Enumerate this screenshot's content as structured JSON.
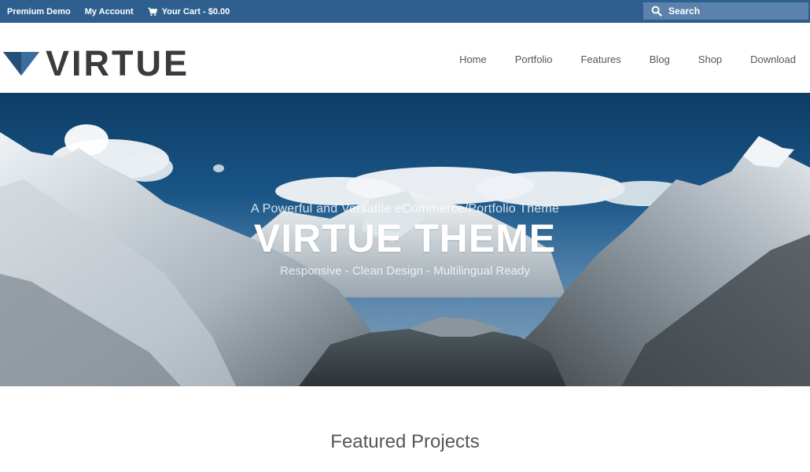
{
  "topbar": {
    "links": [
      "Premium Demo",
      "My Account"
    ],
    "cart_label": "Your Cart - $0.00",
    "search_placeholder": "Search"
  },
  "header": {
    "logo_text": "VIRTUE",
    "nav": [
      "Home",
      "Portfolio",
      "Features",
      "Blog",
      "Shop",
      "Download"
    ]
  },
  "hero": {
    "subtitle": "A Powerful and Versatile eCommerce/Portfolio Theme",
    "title": "VIRTUE THEME",
    "tagline": "Responsive - Clean Design - Multilingual Ready"
  },
  "featured": {
    "title": "Featured Projects"
  },
  "colors": {
    "topbar": "#2f5f8f",
    "search_bg": "#5a82ad",
    "logo_mark": "#2c5f8c",
    "logo_text": "#3b3b3b"
  }
}
